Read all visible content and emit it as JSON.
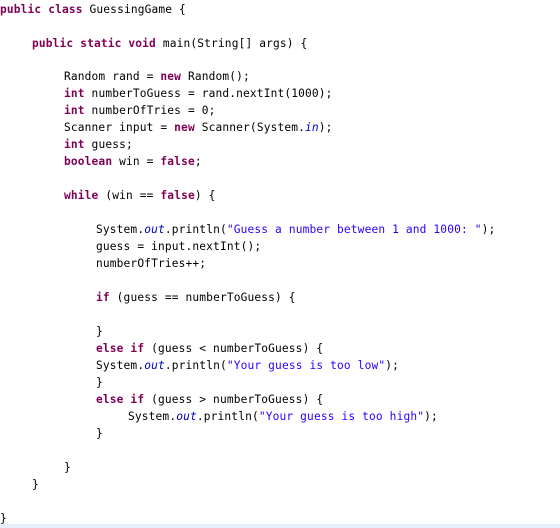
{
  "editor": {
    "language": "java",
    "colors": {
      "keyword": "#7f0055",
      "string": "#2a00ff",
      "static_field": "#0000c0",
      "text": "#000000"
    },
    "lines": [
      {
        "indent": 0,
        "tokens": [
          {
            "t": "kw",
            "v": "public class"
          },
          {
            "t": "p",
            "v": " GuessingGame {"
          }
        ]
      },
      {
        "indent": 1,
        "tokens": [
          {
            "t": "kw",
            "v": "public static void"
          },
          {
            "t": "p",
            "v": " main(String[] args) {"
          }
        ]
      },
      {
        "indent": 2,
        "tokens": [
          {
            "t": "p",
            "v": "Random rand = "
          },
          {
            "t": "kw",
            "v": "new"
          },
          {
            "t": "p",
            "v": " Random();"
          }
        ]
      },
      {
        "indent": 2,
        "tokens": [
          {
            "t": "kw",
            "v": "int"
          },
          {
            "t": "p",
            "v": " numberToGuess = rand.nextInt(1000);"
          }
        ]
      },
      {
        "indent": 2,
        "tokens": [
          {
            "t": "kw",
            "v": "int"
          },
          {
            "t": "p",
            "v": " numberOfTries = 0;"
          }
        ]
      },
      {
        "indent": 2,
        "tokens": [
          {
            "t": "p",
            "v": "Scanner input = "
          },
          {
            "t": "kw",
            "v": "new"
          },
          {
            "t": "p",
            "v": " Scanner(System."
          },
          {
            "t": "fld",
            "v": "in"
          },
          {
            "t": "p",
            "v": ");"
          }
        ]
      },
      {
        "indent": 2,
        "tokens": [
          {
            "t": "kw",
            "v": "int"
          },
          {
            "t": "p",
            "v": " guess;"
          }
        ]
      },
      {
        "indent": 2,
        "tokens": [
          {
            "t": "kw",
            "v": "boolean"
          },
          {
            "t": "p",
            "v": " win = "
          },
          {
            "t": "kw",
            "v": "false"
          },
          {
            "t": "p",
            "v": ";"
          }
        ]
      },
      {
        "indent": 2,
        "tokens": [
          {
            "t": "kw",
            "v": "while"
          },
          {
            "t": "p",
            "v": " (win == "
          },
          {
            "t": "kw",
            "v": "false"
          },
          {
            "t": "p",
            "v": ") {"
          }
        ]
      },
      {
        "indent": 3,
        "tokens": [
          {
            "t": "p",
            "v": "System."
          },
          {
            "t": "fld",
            "v": "out"
          },
          {
            "t": "p",
            "v": ".println("
          },
          {
            "t": "str",
            "v": "\"Guess a number between 1 and 1000: \""
          },
          {
            "t": "p",
            "v": ");"
          }
        ]
      },
      {
        "indent": 3,
        "tokens": [
          {
            "t": "p",
            "v": "guess = input.nextInt();"
          }
        ]
      },
      {
        "indent": 3,
        "tokens": [
          {
            "t": "p",
            "v": "numberOfTries++;"
          }
        ]
      },
      {
        "indent": 3,
        "tokens": [
          {
            "t": "kw",
            "v": "if"
          },
          {
            "t": "p",
            "v": " (guess == numberToGuess) {"
          }
        ]
      },
      {
        "indent": 3,
        "tokens": [
          {
            "t": "p",
            "v": "}"
          }
        ]
      },
      {
        "indent": 3,
        "tokens": [
          {
            "t": "kw",
            "v": "else if"
          },
          {
            "t": "p",
            "v": " (guess < numberToGuess) {"
          }
        ]
      },
      {
        "indent": 3,
        "tokens": [
          {
            "t": "p",
            "v": "System."
          },
          {
            "t": "fld",
            "v": "out"
          },
          {
            "t": "p",
            "v": ".println("
          },
          {
            "t": "str",
            "v": "\"Your guess is too low\""
          },
          {
            "t": "p",
            "v": ");"
          }
        ]
      },
      {
        "indent": 3,
        "tokens": [
          {
            "t": "p",
            "v": "}"
          }
        ]
      },
      {
        "indent": 3,
        "tokens": [
          {
            "t": "kw",
            "v": "else if"
          },
          {
            "t": "p",
            "v": " (guess > numberToGuess) {"
          }
        ]
      },
      {
        "indent": 4,
        "tokens": [
          {
            "t": "p",
            "v": "System."
          },
          {
            "t": "fld",
            "v": "out"
          },
          {
            "t": "p",
            "v": ".println("
          },
          {
            "t": "str",
            "v": "\"Your guess is too high\""
          },
          {
            "t": "p",
            "v": ");"
          }
        ]
      },
      {
        "indent": 3,
        "tokens": [
          {
            "t": "p",
            "v": "}"
          }
        ]
      },
      {
        "indent": 2,
        "tokens": [
          {
            "t": "p",
            "v": "}"
          }
        ]
      },
      {
        "indent": 1,
        "tokens": [
          {
            "t": "p",
            "v": "}"
          }
        ]
      },
      {
        "indent": 0,
        "tokens": [
          {
            "t": "p",
            "v": "}"
          }
        ]
      }
    ]
  }
}
